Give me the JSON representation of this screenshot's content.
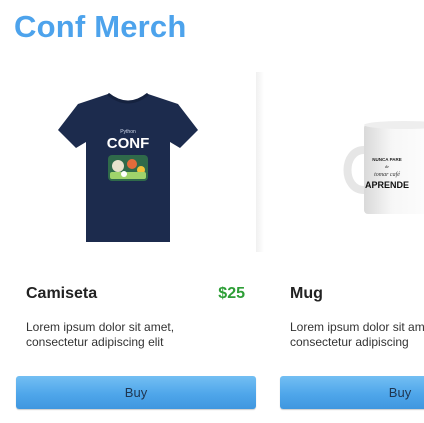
{
  "header": {
    "title": "Conf Merch"
  },
  "products": [
    {
      "name": "Camiseta",
      "price": "$25",
      "description_line1": "Lorem ipsum dolor sit amet,",
      "description_line2": "consectetur adipiscing elit",
      "buy_label": "Buy",
      "image_text": "CONF",
      "image_small_text": "Python"
    },
    {
      "name": "Mug",
      "description_line1": "Lorem ipsum dolor sit amet,",
      "description_line2": "consectetur adipiscing",
      "buy_label": "Buy",
      "image_text_1": "NUNCA PARE",
      "image_text_2": "de",
      "image_text_3": "tomar café",
      "image_text_4": "APRENDE"
    }
  ],
  "colors": {
    "title": "#4da3ec",
    "price": "#2d9e36",
    "button": "#4fa6ea",
    "tshirt": "#1c2b4d"
  }
}
